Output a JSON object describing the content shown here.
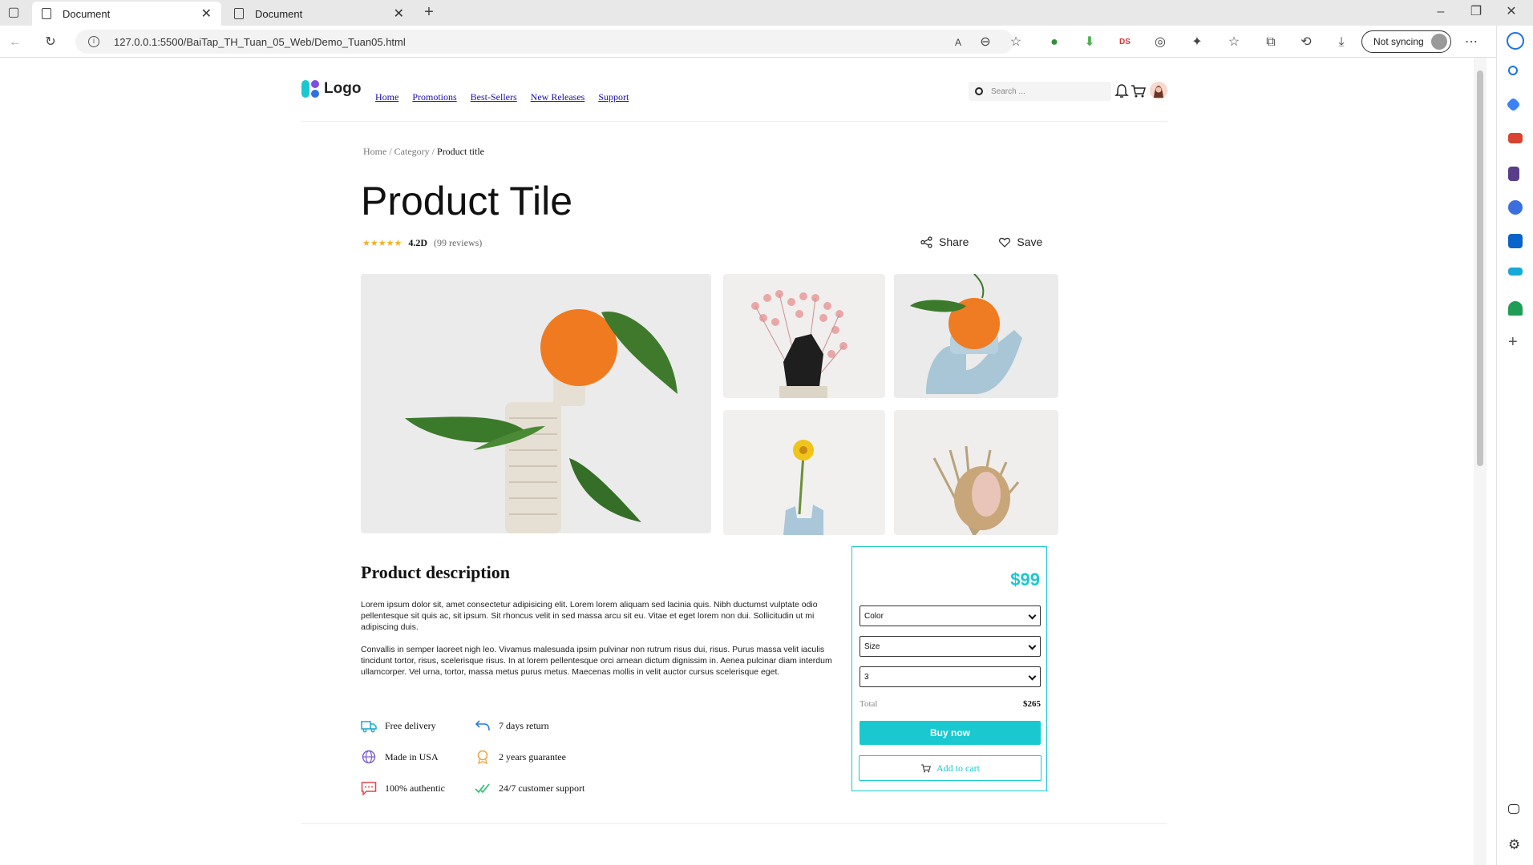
{
  "browser": {
    "tabs": [
      {
        "label": "Document",
        "active": true
      },
      {
        "label": "Document",
        "active": false
      }
    ],
    "url": "127.0.0.1:5500/BaiTap_TH_Tuan_05_Web/Demo_Tuan05.html",
    "sync_label": "Not syncing"
  },
  "header": {
    "logo_text": "Logo",
    "nav": [
      "Home",
      "Promotions",
      "Best-Sellers",
      "New Releases",
      "Support"
    ],
    "search_placeholder": "Search ..."
  },
  "breadcrumb": {
    "home": "Home",
    "category": "Category",
    "current": "Product title"
  },
  "product": {
    "title": "Product Tile",
    "rating": {
      "stars": 4.5,
      "score": "4.2D",
      "reviews": "(99 reviews)"
    },
    "share_label": "Share",
    "save_label": "Save"
  },
  "description": {
    "title": "Product description",
    "paragraphs": [
      "Lorem ipsum dolor sit, amet consectetur adipisicing elit. Lorem lorem aliquam sed lacinia quis. Nibh ductumst vulptate odio pellentesque sit quis ac, sit ipsum. Sit rhoncus velit in sed massa arcu sit eu. Vitae et eget lorem non dui. Sollicitudin ut mi adipiscing duis.",
      "Convallis in semper laoreet nigh leo. Vivamus malesuada ipsim pulvinar non rutrum risus dui, risus. Purus massa velit iaculis tincidunt tortor, risus, scelerisque risus. In at lorem pellentesque orci arnean dictum dignissim in. Aenea pulcinar diam interdum ullamcorper. Vel urna, tortor, massa metus purus metus. Maecenas mollis in velit auctor cursus scelerisque eget."
    ]
  },
  "features": [
    {
      "icon": "truck-icon",
      "label": "Free delivery",
      "color": "#19a8cf"
    },
    {
      "icon": "return-arrow-icon",
      "label": "7 days return",
      "color": "#2b7bd6"
    },
    {
      "icon": "globe-icon",
      "label": "Made in USA",
      "color": "#7a5bd6"
    },
    {
      "icon": "medal-icon",
      "label": "2 years guarantee",
      "color": "#f0a33a"
    },
    {
      "icon": "chat-icon",
      "label": "100% authentic",
      "color": "#e04646"
    },
    {
      "icon": "double-check-icon",
      "label": "24/7 customer support",
      "color": "#2fbf6f"
    }
  ],
  "buybox": {
    "price": "$99",
    "color_select": "Color",
    "size_select": "Size",
    "quantity_select": "3",
    "total_label": "Total",
    "total_value": "$265",
    "buy_label": "Buy now",
    "cart_label": "Add to cart",
    "accent": "#19c9cf"
  }
}
